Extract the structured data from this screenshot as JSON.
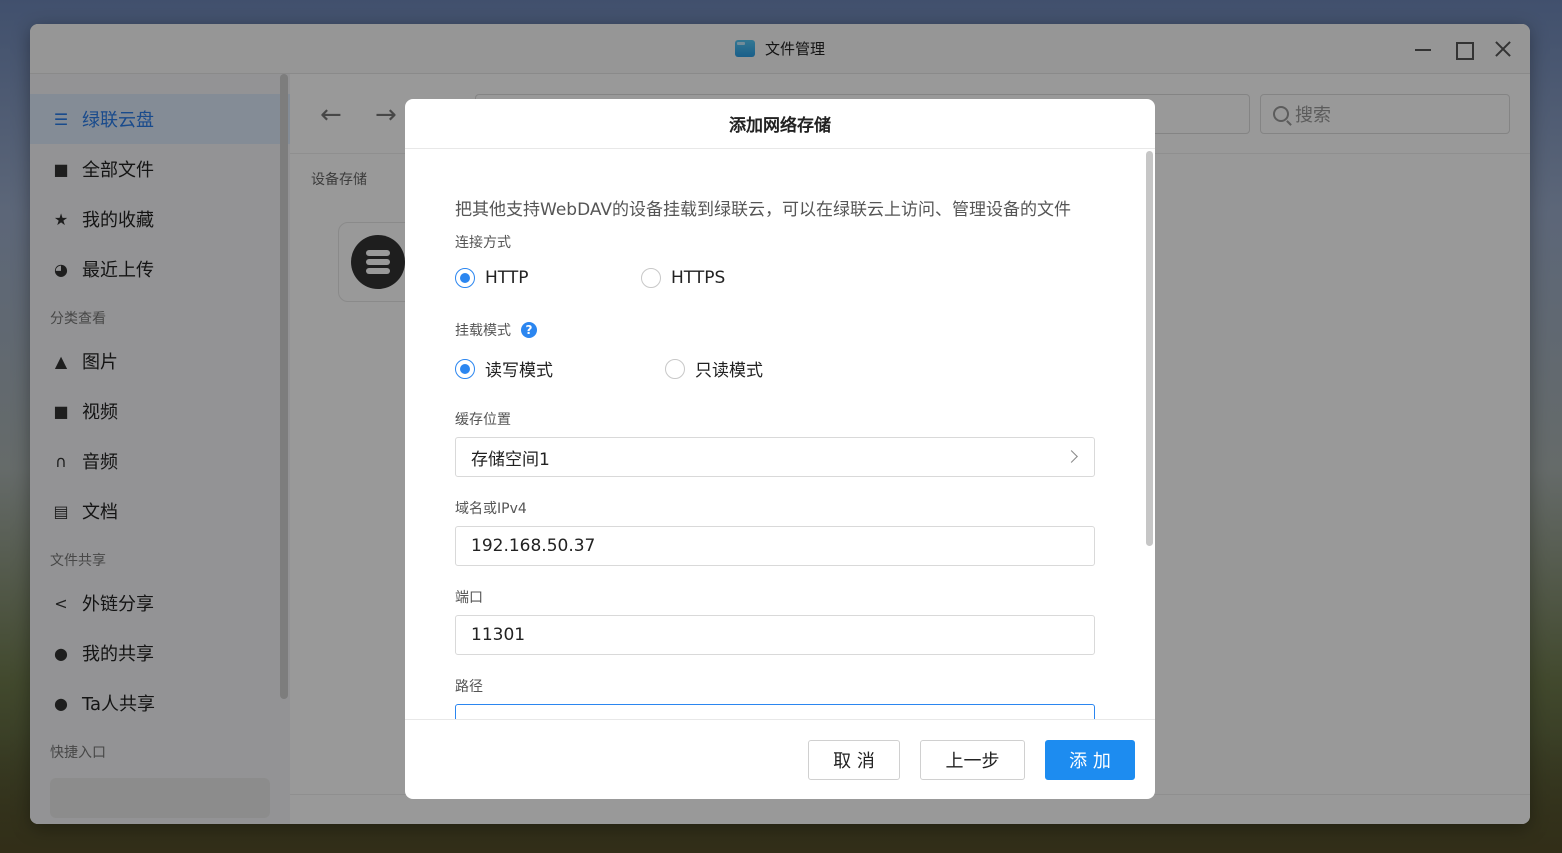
{
  "window": {
    "title": "文件管理"
  },
  "sidebar": {
    "items": [
      {
        "label": "绿联云盘",
        "icon": "list-icon",
        "active": true
      },
      {
        "label": "全部文件",
        "icon": "file-icon"
      },
      {
        "label": "我的收藏",
        "icon": "star-icon"
      },
      {
        "label": "最近上传",
        "icon": "clock-icon"
      }
    ],
    "section_category": "分类查看",
    "category_items": [
      {
        "label": "图片",
        "icon": "image-icon"
      },
      {
        "label": "视频",
        "icon": "video-icon"
      },
      {
        "label": "音频",
        "icon": "headphones-icon"
      },
      {
        "label": "文档",
        "icon": "document-icon"
      }
    ],
    "section_share": "文件共享",
    "share_items": [
      {
        "label": "外链分享",
        "icon": "share-icon"
      },
      {
        "label": "我的共享",
        "icon": "user-share-icon"
      },
      {
        "label": "Ta人共享",
        "icon": "users-icon"
      }
    ],
    "section_quick": "快捷入口"
  },
  "toolbar": {
    "search_placeholder": "搜索"
  },
  "main": {
    "breadcrumb": "设备存储"
  },
  "dialog": {
    "title": "添加网络存储",
    "description": "把其他支持WebDAV的设备挂载到绿联云，可以在绿联云上访问、管理设备的文件",
    "connection": {
      "label": "连接方式",
      "options": [
        "HTTP",
        "HTTPS"
      ],
      "selected": "HTTP"
    },
    "mount": {
      "label": "挂载模式",
      "options": [
        "读写模式",
        "只读模式"
      ],
      "selected": "读写模式"
    },
    "cache": {
      "label": "缓存位置",
      "value": "存储空间1"
    },
    "host": {
      "label": "域名或IPv4",
      "value": "192.168.50.37"
    },
    "port": {
      "label": "端口",
      "value": "11301"
    },
    "path": {
      "label": "路径",
      "value": ""
    },
    "buttons": {
      "cancel": "取 消",
      "back": "上一步",
      "add": "添 加"
    },
    "colors": {
      "accent": "#1d8cf0"
    }
  }
}
